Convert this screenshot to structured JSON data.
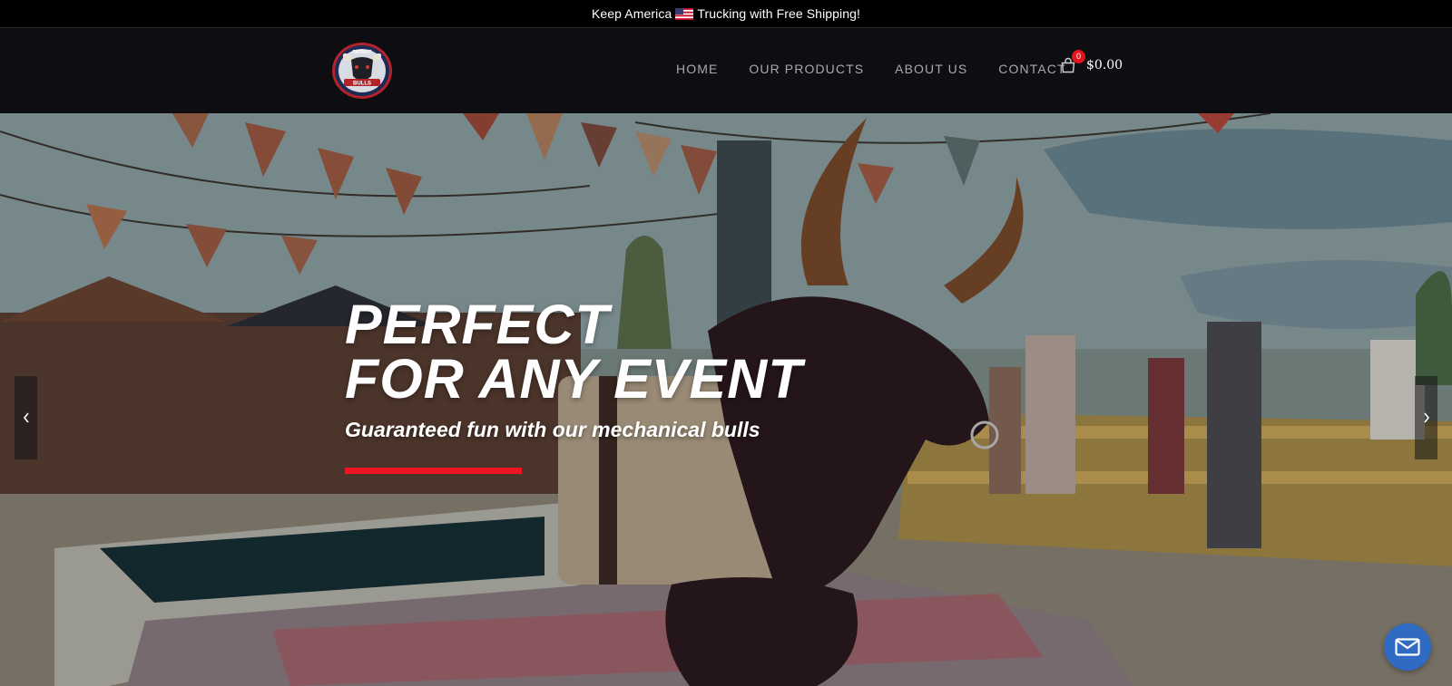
{
  "topbar": {
    "text_before": "Keep America",
    "text_after": "Trucking with Free Shipping!",
    "flag_icon": "us-flag-icon"
  },
  "header": {
    "logo": {
      "icon": "bull-logo-icon",
      "top_text": "PATRIOT",
      "bottom_text": "BULLS"
    },
    "nav": [
      {
        "label": "HOME"
      },
      {
        "label": "OUR PRODUCTS"
      },
      {
        "label": "ABOUT US"
      },
      {
        "label": "CONTACT"
      }
    ],
    "cart": {
      "icon": "shopping-bag-icon",
      "count": "0",
      "total": "$0.00"
    }
  },
  "hero": {
    "title_line1": "PERFECT",
    "title_line2": "FOR ANY EVENT",
    "subtitle": "Guaranteed fun with our mechanical bulls",
    "accent_color": "#ee1523",
    "prev_icon": "chevron-left-icon",
    "next_icon": "chevron-right-icon"
  },
  "contact_widget": {
    "icon": "envelope-icon",
    "color": "#2f6bc3"
  }
}
